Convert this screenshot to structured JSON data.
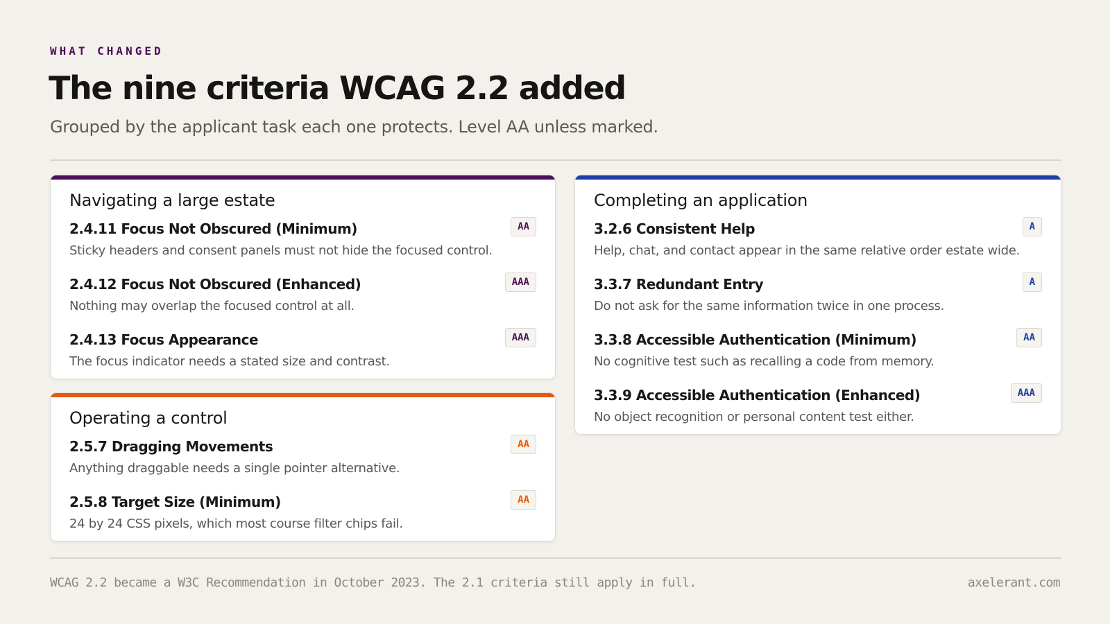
{
  "header": {
    "eyebrow": "WHAT CHANGED",
    "title": "The nine criteria WCAG 2.2 added",
    "subtitle": "Grouped by the applicant task each one protects. Level AA unless marked."
  },
  "groups": [
    {
      "title": "Navigating a large estate",
      "accent": "#4b1059",
      "criteria": [
        {
          "name": "2.4.11 Focus Not Obscured (Minimum)",
          "level": "AA",
          "desc": "Sticky headers and consent panels must not hide the focused control."
        },
        {
          "name": "2.4.12 Focus Not Obscured (Enhanced)",
          "level": "AAA",
          "desc": "Nothing may overlap the focused control at all."
        },
        {
          "name": "2.4.13 Focus Appearance",
          "level": "AAA",
          "desc": "The focus indicator needs a stated size and contrast."
        }
      ]
    },
    {
      "title": "Operating a control",
      "accent": "#e35b12",
      "criteria": [
        {
          "name": "2.5.7 Dragging Movements",
          "level": "AA",
          "desc": "Anything draggable needs a single pointer alternative."
        },
        {
          "name": "2.5.8 Target Size (Minimum)",
          "level": "AA",
          "desc": "24 by 24 CSS pixels, which most course filter chips fail."
        }
      ]
    },
    {
      "title": "Completing an application",
      "accent": "#1f3fa6",
      "criteria": [
        {
          "name": "3.2.6 Consistent Help",
          "level": "A",
          "desc": "Help, chat, and contact appear in the same relative order estate wide."
        },
        {
          "name": "3.3.7 Redundant Entry",
          "level": "A",
          "desc": "Do not ask for the same information twice in one process."
        },
        {
          "name": "3.3.8 Accessible Authentication (Minimum)",
          "level": "AA",
          "desc": "No cognitive test such as recalling a code from memory."
        },
        {
          "name": "3.3.9 Accessible Authentication (Enhanced)",
          "level": "AAA",
          "desc": "No object recognition or personal content test either."
        }
      ]
    }
  ],
  "footer": {
    "note": "WCAG 2.2 became a W3C Recommendation in October 2023. The 2.1 criteria still apply in full.",
    "site": "axelerant.com"
  }
}
